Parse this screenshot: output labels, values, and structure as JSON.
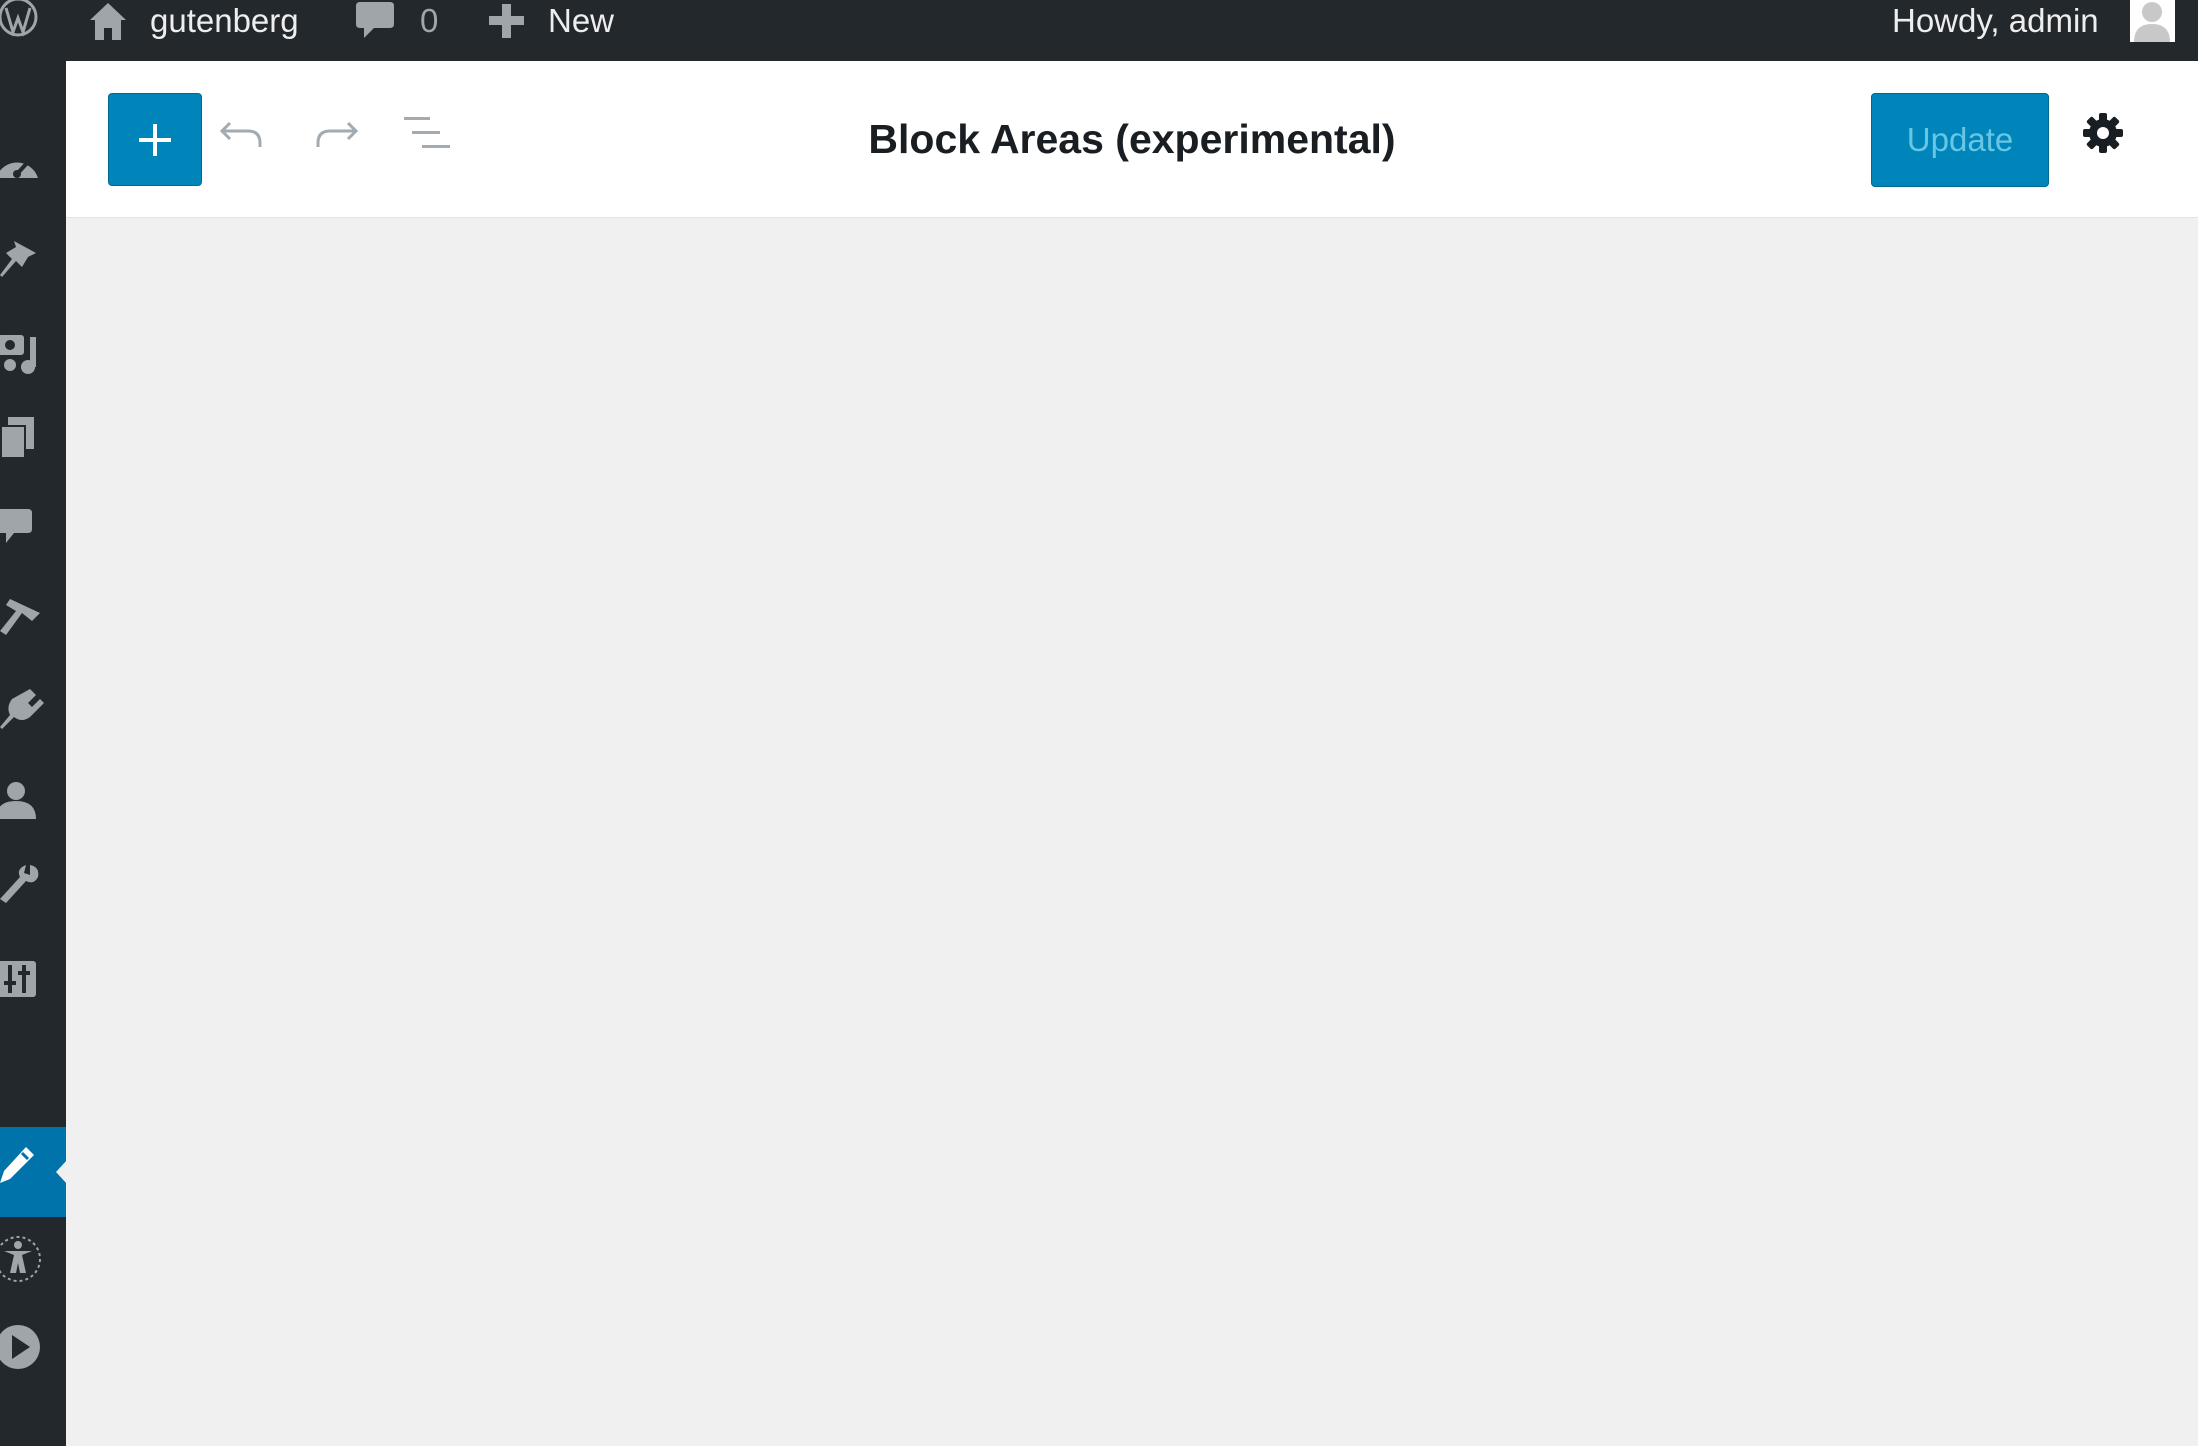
{
  "admin_bar": {
    "wp_logo_icon": "wordpress-logo-icon",
    "home_icon": "home-icon",
    "site_name": "gutenberg",
    "comments_icon": "comment-bubble-icon",
    "comments_count": "0",
    "new_icon": "plus-icon",
    "new_label": "New",
    "howdy": "Howdy, admin",
    "avatar_icon": "user-avatar-icon"
  },
  "admin_menu": {
    "items": [
      {
        "icon": "dashboard-icon"
      },
      {
        "icon": "pushpin-icon"
      },
      {
        "icon": "media-icon"
      },
      {
        "icon": "pages-icon"
      },
      {
        "icon": "comments-icon"
      },
      {
        "icon": "appearance-brush-icon"
      },
      {
        "icon": "plugins-icon"
      },
      {
        "icon": "users-icon"
      },
      {
        "icon": "tools-wrench-icon"
      },
      {
        "icon": "settings-sliders-icon"
      },
      {
        "icon": "edit-pencil-icon",
        "active": true
      },
      {
        "icon": "accessibility-icon"
      },
      {
        "icon": "play-icon"
      }
    ],
    "active_color": "#0073aa"
  },
  "editor_header": {
    "inserter_icon": "plus-icon",
    "undo_icon": "undo-icon",
    "redo_icon": "redo-icon",
    "outline_icon": "block-navigation-icon",
    "title": "Block Areas (experimental)",
    "update_label": "Update",
    "settings_icon": "gear-icon"
  },
  "colors": {
    "admin_bar_bg": "#23282d",
    "primary_button": "#0085ba",
    "canvas_bg": "#f0f0f0",
    "header_bg": "#ffffff"
  }
}
